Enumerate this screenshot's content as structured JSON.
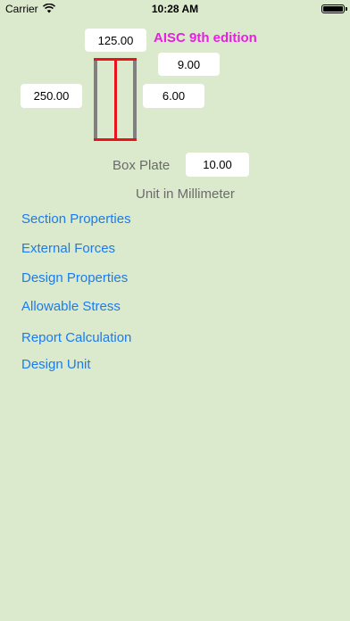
{
  "status_bar": {
    "carrier": "Carrier",
    "time": "10:28 AM"
  },
  "header": {
    "edition": "AISC 9th edition"
  },
  "inputs": {
    "flange_width": "125.00",
    "flange_thickness": "9.00",
    "depth": "250.00",
    "web_thickness": "6.00",
    "box_plate": "10.00"
  },
  "labels": {
    "box_plate": "Box Plate",
    "unit": "Unit in Millimeter"
  },
  "menu": {
    "section_properties": "Section Properties",
    "external_forces": "External Forces",
    "design_properties": "Design Properties",
    "allowable_stress": "Allowable Stress",
    "report_calculation": "Report Calculation",
    "design_unit": "Design Unit"
  },
  "colors": {
    "background": "#dbe9cc",
    "edition": "#e61fe0",
    "link": "#1a7cf0",
    "plate_red": "#e8131b",
    "plate_gray": "#808080"
  }
}
